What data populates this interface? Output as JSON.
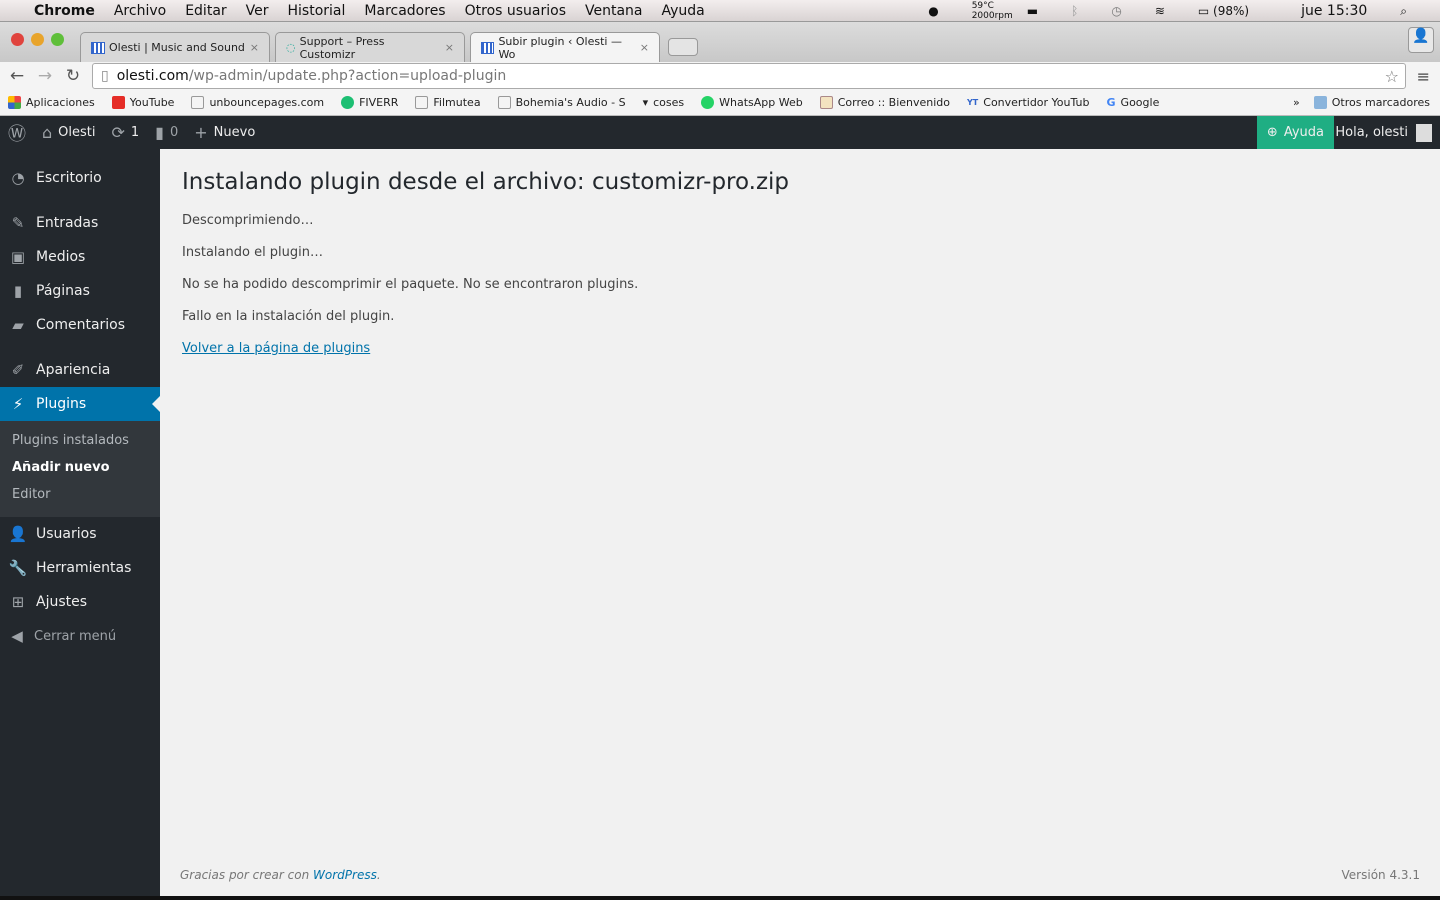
{
  "os_menubar": {
    "app": "Chrome",
    "items": [
      "Archivo",
      "Editar",
      "Ver",
      "Historial",
      "Marcadores",
      "Otros usuarios",
      "Ventana",
      "Ayuda"
    ],
    "temp": "59°C",
    "fan": "2000rpm",
    "battery": "(98%)",
    "clock": "jue 15:30"
  },
  "tabs": [
    {
      "title": "Olesti | Music and Sound"
    },
    {
      "title": "Support – Press Customizr"
    },
    {
      "title": "Subir plugin ‹ Olesti — Wo"
    }
  ],
  "address": {
    "host": "olesti.com",
    "path": "/wp-admin/update.php?action=upload-plugin"
  },
  "bookmarks": [
    {
      "label": "Aplicaciones",
      "color": "#e44"
    },
    {
      "label": "YouTube",
      "color": "#e52d27"
    },
    {
      "label": "unbouncepages.com",
      "color": "#fff"
    },
    {
      "label": "FIVERR",
      "color": "#1dbf73"
    },
    {
      "label": "Filmutea",
      "color": "#fff"
    },
    {
      "label": "Bohemia's Audio - S",
      "color": "#fff"
    },
    {
      "label": "coses",
      "color": "#f4f4f4"
    },
    {
      "label": "WhatsApp Web",
      "color": "#25d366"
    },
    {
      "label": "Correo :: Bienvenido",
      "color": "#f3e3c0"
    },
    {
      "label": "Convertidor YouTub",
      "color": "#36c"
    },
    {
      "label": "Google",
      "color": "#4285f4"
    }
  ],
  "bookmarks_other": "Otros marcadores",
  "adminbar": {
    "site": "Olesti",
    "updates": "1",
    "comments": "0",
    "new": "Nuevo",
    "help": "Ayuda",
    "greeting": "Hola, olesti",
    "help_color": "#1fae83"
  },
  "sidebar": {
    "items": [
      {
        "label": "Escritorio",
        "icon": "dashboard-icon"
      },
      {
        "label": "Entradas",
        "icon": "pin-icon"
      },
      {
        "label": "Medios",
        "icon": "media-icon"
      },
      {
        "label": "Páginas",
        "icon": "page-icon"
      },
      {
        "label": "Comentarios",
        "icon": "comment-icon"
      },
      {
        "label": "Apariencia",
        "icon": "brush-icon"
      },
      {
        "label": "Plugins",
        "icon": "plugin-icon",
        "active": true
      },
      {
        "label": "Usuarios",
        "icon": "user-icon"
      },
      {
        "label": "Herramientas",
        "icon": "wrench-icon"
      },
      {
        "label": "Ajustes",
        "icon": "settings-icon"
      },
      {
        "label": "Cerrar menú",
        "icon": "collapse-icon"
      }
    ],
    "submenu": [
      "Plugins instalados",
      "Añadir nuevo",
      "Editor"
    ],
    "accent": "#0073aa"
  },
  "main": {
    "title": "Instalando plugin desde el archivo: customizr-pro.zip",
    "messages": [
      "Descomprimiendo…",
      "Instalando el plugin…",
      "No se ha podido descomprimir el paquete. No se encontraron plugins.",
      "Fallo en la instalación del plugin."
    ],
    "back_link": "Volver a la página de plugins"
  },
  "footer": {
    "text": "Gracias por crear con ",
    "link": "WordPress",
    "end": ".",
    "version": "Versión 4.3.1"
  }
}
